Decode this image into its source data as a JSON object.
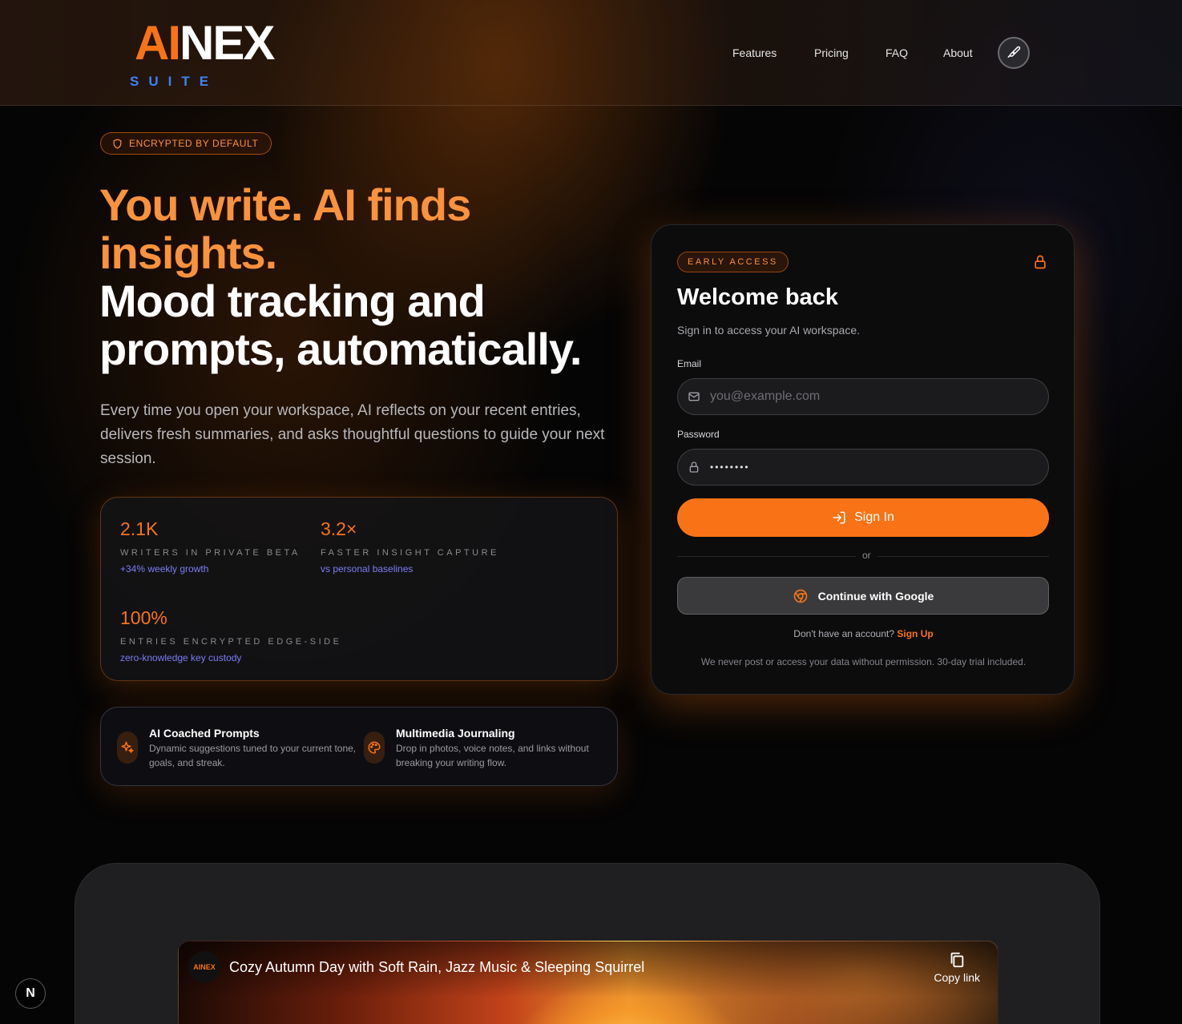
{
  "header": {
    "logo": {
      "ai": "AI",
      "nex": "NEX",
      "suite": "SUITE"
    },
    "nav": [
      "Features",
      "Pricing",
      "FAQ",
      "About"
    ],
    "theme_button_icon": "paintbrush-icon"
  },
  "hero": {
    "badge": "ENCRYPTED BY DEFAULT",
    "badge_icon": "shield-icon",
    "headline_orange": "You write. AI finds insights.",
    "headline_white": "Mood tracking and prompts, automatically.",
    "subtext": "Every time you open your workspace, AI reflects on your recent entries, delivers fresh summaries, and asks thoughtful questions to guide your next session."
  },
  "stats": [
    {
      "value": "2.1K",
      "label": "WRITERS IN PRIVATE BETA",
      "sub": "+34% weekly growth"
    },
    {
      "value": "3.2×",
      "label": "FASTER INSIGHT CAPTURE",
      "sub": "vs personal baselines"
    },
    {
      "value": "100%",
      "label": "ENTRIES ENCRYPTED EDGE-SIDE",
      "sub": "zero-knowledge key custody"
    }
  ],
  "features": [
    {
      "icon": "sparkles-icon",
      "title": "AI Coached Prompts",
      "desc": "Dynamic suggestions tuned to your current tone, goals, and streak."
    },
    {
      "icon": "palette-icon",
      "title": "Multimedia Journaling",
      "desc": "Drop in photos, voice notes, and links without breaking your writing flow."
    }
  ],
  "login": {
    "badge": "EARLY ACCESS",
    "title": "Welcome back",
    "subtitle": "Sign in to access your AI workspace.",
    "email_label": "Email",
    "email_placeholder": "you@example.com",
    "password_label": "Password",
    "password_value": "••••••••",
    "signin_label": "Sign In",
    "divider": "or",
    "google_label": "Continue with Google",
    "signup_prompt": "Don't have an account?",
    "signup_link": "Sign Up",
    "disclaimer": "We never post or access your data without permission. 30-day trial included."
  },
  "video": {
    "channel": "AINEX",
    "title": "Cozy Autumn Day with Soft Rain, Jazz Music & Sleeping Squirrel",
    "copy_label": "Copy link"
  },
  "dev_badge": "N",
  "colors": {
    "accent": "#f97316",
    "accent_light": "#fb923c",
    "brand_blue": "#3b82f6",
    "stat_sub": "#7c7cf5"
  }
}
